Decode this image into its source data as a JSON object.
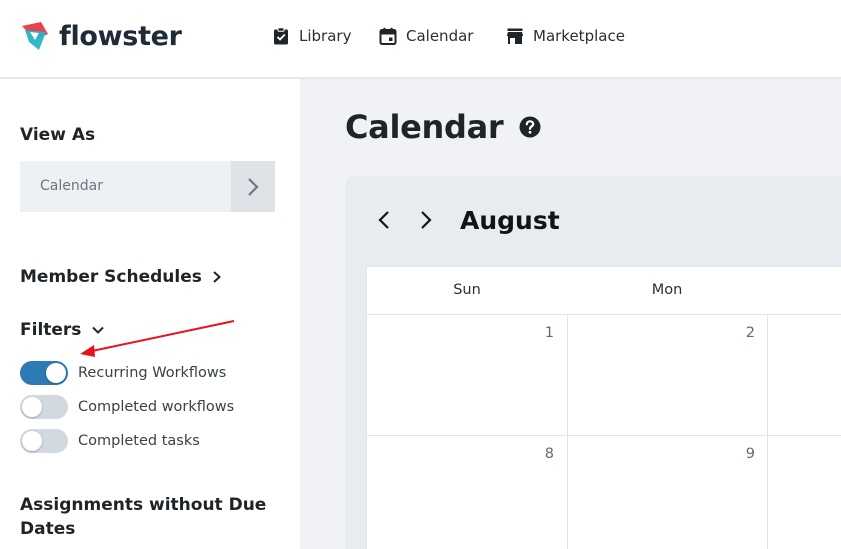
{
  "header": {
    "brand": "flowster",
    "nav": [
      {
        "label": "Library",
        "icon": "clipboard-check-icon"
      },
      {
        "label": "Calendar",
        "icon": "calendar-icon"
      },
      {
        "label": "Marketplace",
        "icon": "store-icon"
      }
    ]
  },
  "sidebar": {
    "view_as_heading": "View As",
    "view_as_value": "Calendar",
    "member_schedules": "Member Schedules",
    "filters_heading": "Filters",
    "toggles": [
      {
        "label": "Recurring Workflows",
        "on": true
      },
      {
        "label": "Completed workflows",
        "on": false
      },
      {
        "label": "Completed tasks",
        "on": false
      }
    ],
    "assignments_heading": "Assignments without Due Dates"
  },
  "main": {
    "title": "Calendar",
    "month": "August",
    "weekdays": [
      "Sun",
      "Mon"
    ],
    "rows": [
      [
        "1",
        "2"
      ],
      [
        "8",
        "9"
      ]
    ]
  },
  "colors": {
    "accent": "#2d7ab4",
    "logo_red": "#e8434f",
    "logo_teal": "#27b5c4",
    "annotation_arrow": "#e8121b"
  }
}
